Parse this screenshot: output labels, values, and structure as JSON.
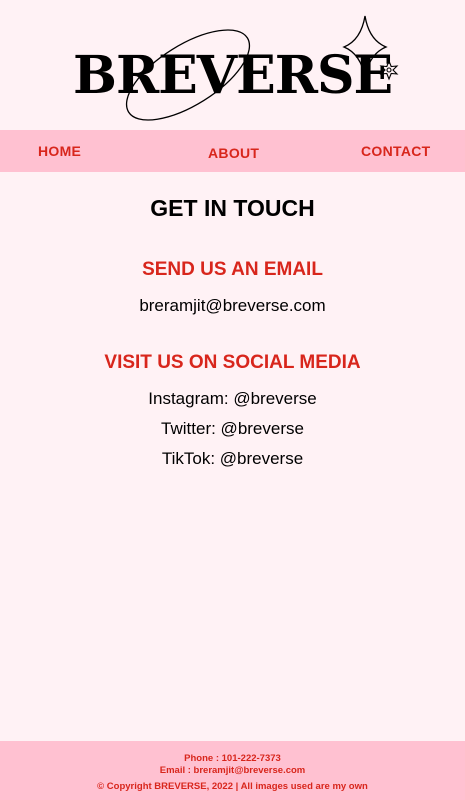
{
  "header": {
    "logo_text": "BREVERSE"
  },
  "nav": {
    "home": "HOME",
    "about": "ABOUT",
    "contact": "CONTACT"
  },
  "main": {
    "title": "GET IN TOUCH",
    "email_heading": "SEND US AN EMAIL",
    "email": "breramjit@breverse.com",
    "social_heading": "VISIT US ON SOCIAL MEDIA",
    "social": [
      "Instagram: @breverse",
      "Twitter: @breverse",
      "TikTok: @breverse"
    ]
  },
  "footer": {
    "phone": "Phone : 101-222-7373",
    "email": "Email : breramjit@breverse.com",
    "copyright": "© Copyright BREVERSE, 2022 | All images used are my own"
  },
  "colors": {
    "background": "#fff2f5",
    "nav_bg": "#ffc1d1",
    "accent": "#d8261c",
    "text": "#000000"
  },
  "icons": [
    "sparkle-star-icon",
    "small-star-icon",
    "orbit-ellipse-icon"
  ]
}
